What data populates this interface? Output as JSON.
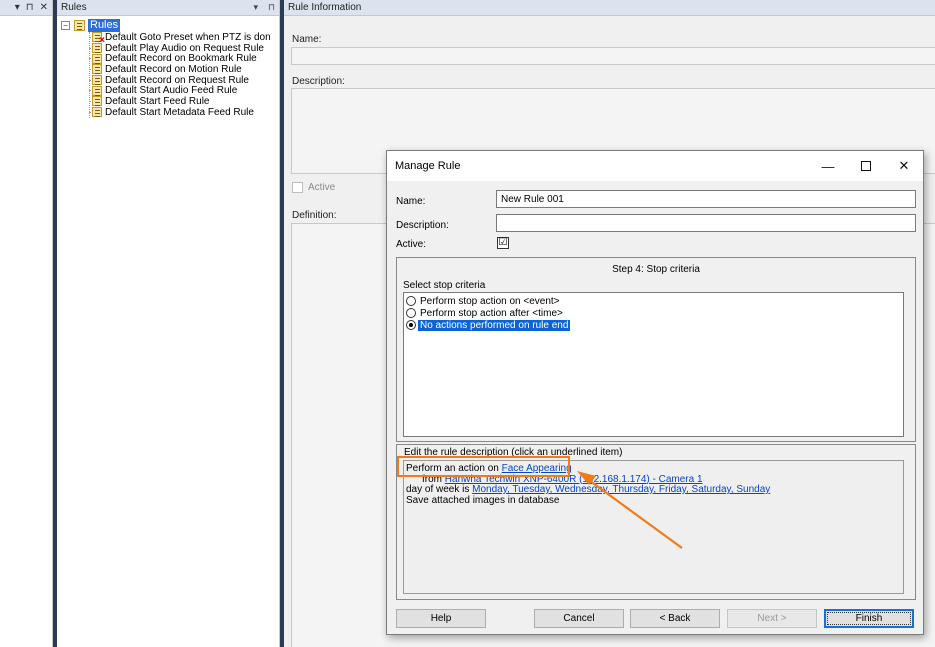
{
  "left_pane": {
    "controls": [
      "▾",
      "⊓",
      "✕"
    ]
  },
  "rules_pane": {
    "title": "Rules",
    "controls": [
      "▾",
      "⊓"
    ],
    "root": {
      "expander": "−",
      "label": "Rules"
    },
    "items": [
      {
        "label": "Default Goto Preset when PTZ is don",
        "error": true
      },
      {
        "label": "Default Play Audio on Request Rule",
        "error": false
      },
      {
        "label": "Default Record on Bookmark Rule",
        "error": false
      },
      {
        "label": "Default Record on Motion Rule",
        "error": false
      },
      {
        "label": "Default Record on Request Rule",
        "error": false
      },
      {
        "label": "Default Start Audio Feed Rule",
        "error": false
      },
      {
        "label": "Default Start Feed Rule",
        "error": false
      },
      {
        "label": "Default Start Metadata Feed Rule",
        "error": false
      }
    ]
  },
  "rule_info": {
    "title": "Rule Information",
    "name_label": "Name:",
    "description_label": "Description:",
    "active_label": "Active",
    "definition_label": "Definition:"
  },
  "dialog": {
    "title": "Manage Rule",
    "window_controls": {
      "minimize": "—",
      "close": "✕"
    },
    "name_label": "Name:",
    "name_value": "New Rule 001",
    "description_label": "Description:",
    "description_value": "",
    "active_label": "Active:",
    "active_mark": "☑",
    "step_title": "Step 4: Stop criteria",
    "select_label": "Select stop criteria",
    "criteria": [
      {
        "label": "Perform stop action on <event>",
        "selected": false
      },
      {
        "label": "Perform stop action after <time>",
        "selected": false
      },
      {
        "label": "No actions performed on rule end",
        "selected": true
      }
    ],
    "edit_title": "Edit the rule description (click an underlined item)",
    "desc": {
      "line1_prefix": "Perform an action on ",
      "line1_link": "Face Appearing",
      "line2_prefix": "from ",
      "line2_link": "Hanwha Techwin XNP-6400R (192.168.1.174) - Camera 1",
      "line3_prefix": "day of week is ",
      "line3_link": "Monday, Tuesday, Wednesday, Thursday, Friday, Saturday, Sunday",
      "line4": "Save attached images in database"
    },
    "buttons": {
      "help": "Help",
      "cancel": "Cancel",
      "back": "< Back",
      "next": "Next >",
      "finish": "Finish"
    }
  },
  "colors": {
    "annotation": "#f07b1b",
    "selection": "#0a64d8",
    "link": "#0645c8"
  }
}
